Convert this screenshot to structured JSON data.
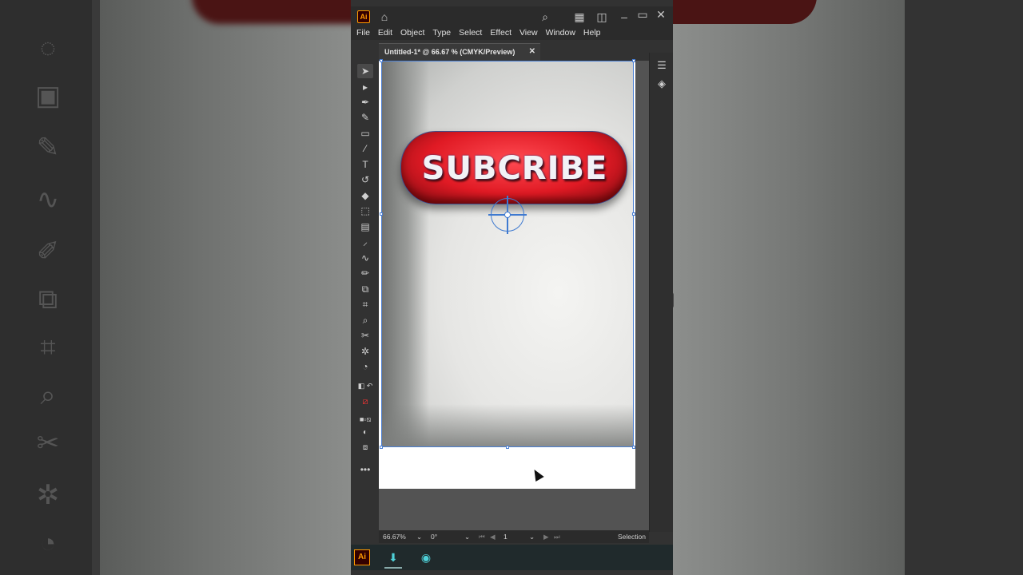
{
  "window": {
    "app_badge": "Ai",
    "icons": [
      "home-icon",
      "search-icon",
      "arrange-documents-icon",
      "workspace-icon",
      "minimize-icon",
      "maximize-icon",
      "close-icon"
    ]
  },
  "menu": [
    "File",
    "Edit",
    "Object",
    "Type",
    "Select",
    "Effect",
    "View",
    "Window",
    "Help"
  ],
  "document_tab": {
    "title": "Untitled-1* @ 66.67 % (CMYK/Preview)",
    "close": "✕"
  },
  "artwork": {
    "button_text": "SUBCRIBE",
    "button_color": "#e01a24"
  },
  "status": {
    "zoom": "66.67%",
    "rotation": "0°",
    "artboard_number": "1",
    "tool_name": "Selection"
  },
  "taskbar": {
    "ai_badge": "Ai"
  }
}
